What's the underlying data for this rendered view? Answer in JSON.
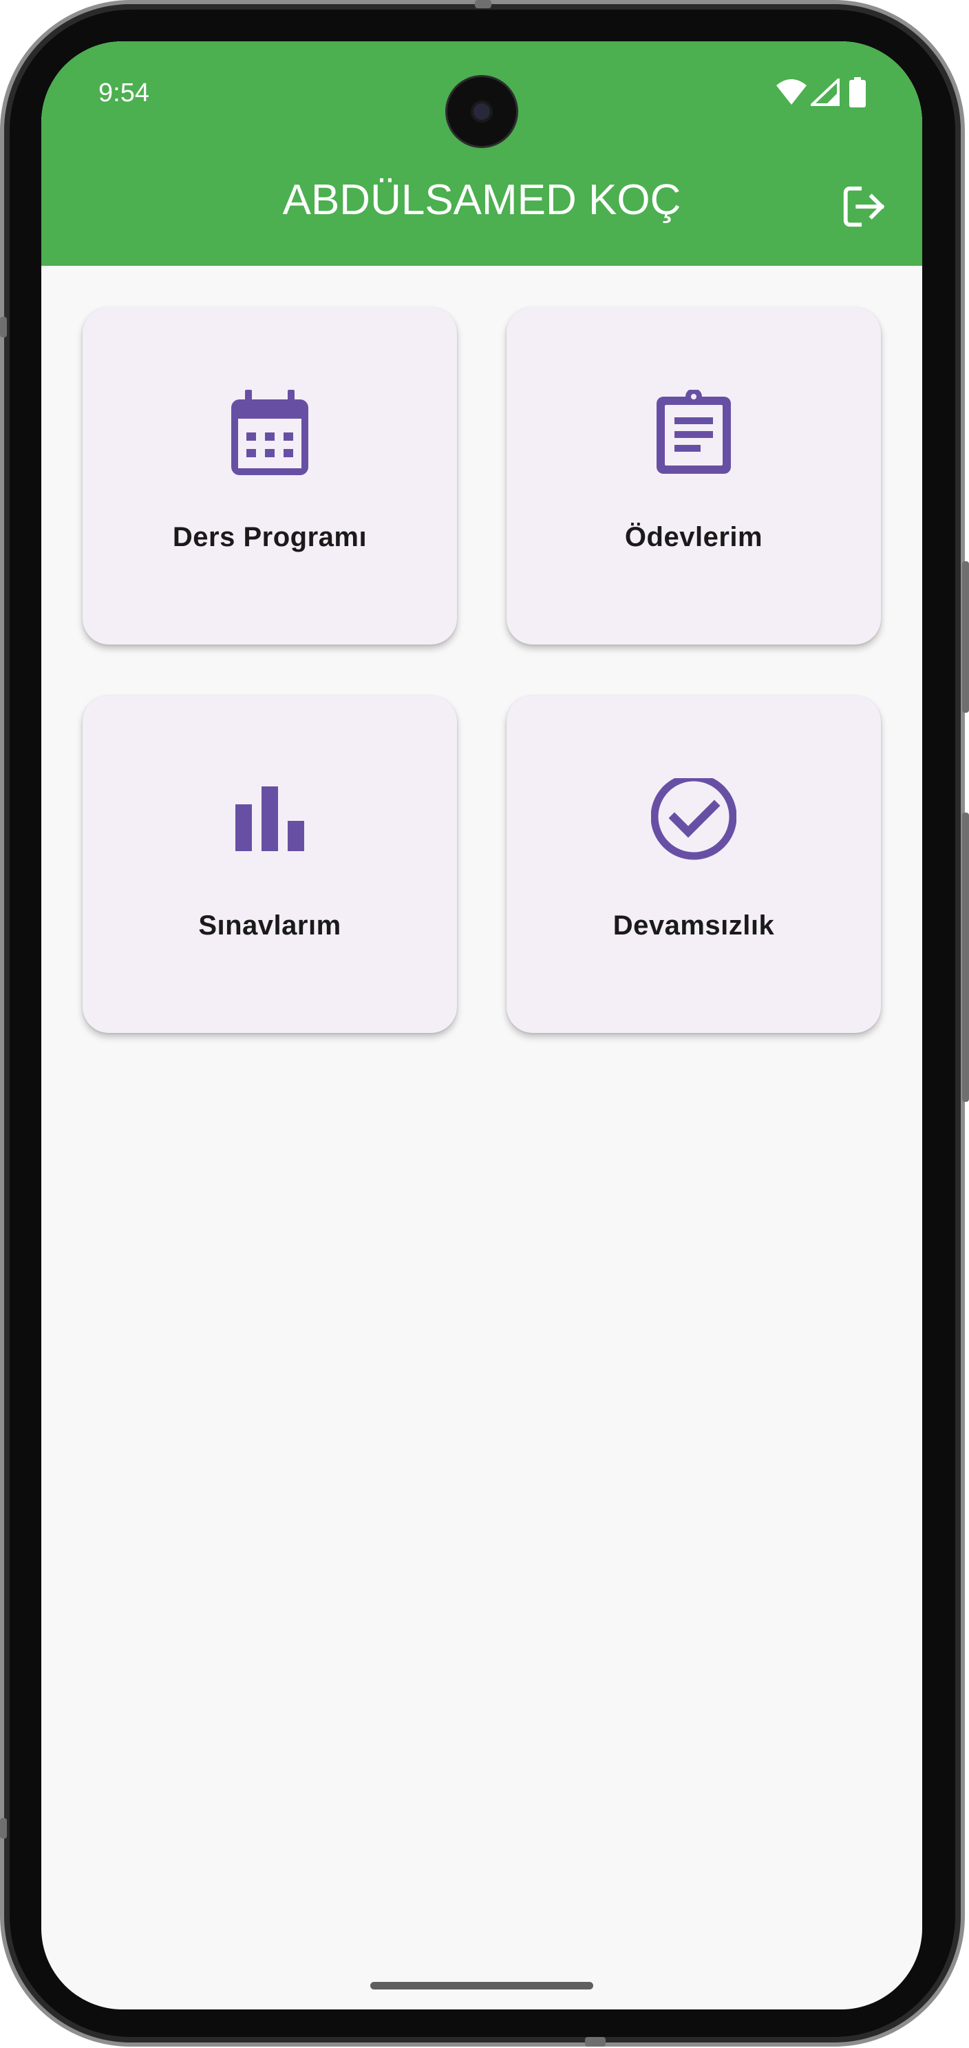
{
  "status_bar": {
    "time": "9:54",
    "icons": [
      "wifi-icon",
      "signal-icon",
      "battery-icon"
    ]
  },
  "app_bar": {
    "title": "ABDÜLSAMED KOÇ",
    "background_color": "#4caf50",
    "logout_icon": "logout-icon"
  },
  "menu": {
    "items": [
      {
        "label": "Ders Programı",
        "icon": "calendar-icon"
      },
      {
        "label": "Ödevlerim",
        "icon": "clipboard-icon"
      },
      {
        "label": "Sınavlarım",
        "icon": "bar-chart-icon"
      },
      {
        "label": "Devamsızlık",
        "icon": "check-circle-icon"
      }
    ],
    "icon_color": "#6750a4",
    "card_color": "#f4eff7"
  }
}
